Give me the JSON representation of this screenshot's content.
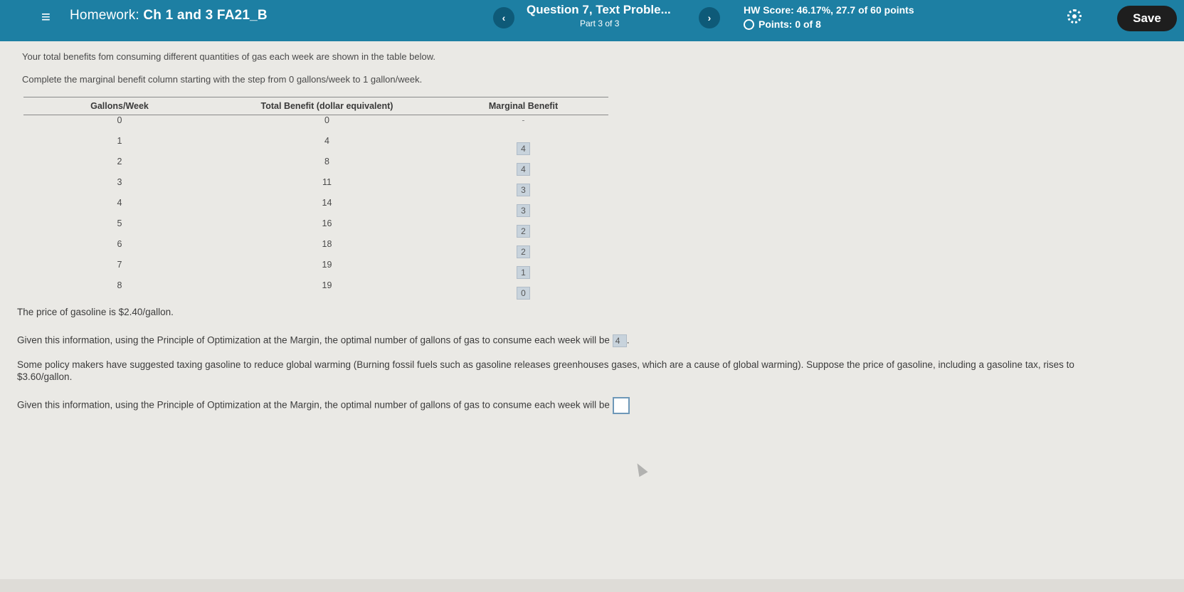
{
  "header": {
    "menu_icon": "hamburger-icon",
    "hw_label": "Homework:",
    "hw_name": "Ch 1 and 3 FA21_B",
    "prev_icon": "chevron-left-icon",
    "prev_glyph": "‹",
    "question_title": "Question 7, Text Proble...",
    "question_part": "Part 3 of 3",
    "next_icon": "chevron-right-icon",
    "next_glyph": "›",
    "hw_score": "HW Score: 46.17%, 27.7 of 60 points",
    "points": "Points: 0 of 8",
    "settings_icon": "gear-icon",
    "save_label": "Save",
    "bar_color": "#1d7fa3"
  },
  "problem": {
    "intro": "Your total benefits fom consuming different quantities of gas each week are shown in the table below.",
    "instruction": "Complete the marginal benefit column starting with the step from 0 gallons/week to 1 gallon/week.",
    "table": {
      "headers": [
        "Gallons/Week",
        "Total Benefit (dollar equivalent)",
        "Marginal Benefit"
      ],
      "rows": [
        {
          "gallons": "0",
          "total": "0",
          "marginal": "-"
        },
        {
          "gallons": "1",
          "total": "4",
          "marginal": "4"
        },
        {
          "gallons": "2",
          "total": "8",
          "marginal": "4"
        },
        {
          "gallons": "3",
          "total": "11",
          "marginal": "3"
        },
        {
          "gallons": "4",
          "total": "14",
          "marginal": "3"
        },
        {
          "gallons": "5",
          "total": "16",
          "marginal": "2"
        },
        {
          "gallons": "6",
          "total": "18",
          "marginal": "2"
        },
        {
          "gallons": "7",
          "total": "19",
          "marginal": "1"
        },
        {
          "gallons": "8",
          "total": "19",
          "marginal": "0"
        }
      ]
    },
    "price_text": "The price of gasoline is $2.40/gallon.",
    "q1_text": "Given this information, using the Principle of Optimization at the Margin, the optimal number of gallons of gas to consume each week will be",
    "q1_answer": "4",
    "q1_suffix": ".",
    "policy_line1": "Some policy makers have suggested taxing gasoline to reduce global warming (Burning fossil fuels such as gasoline releases greenhouses gases, which are a cause of global warming). Suppose the price of gasoline, including a gasoline tax, rises to",
    "policy_line2": "$3.60/gallon.",
    "q2_text": "Given this information, using the Principle of Optimization at the Margin, the optimal number of gallons of gas to consume each week will be",
    "q2_answer": ""
  }
}
